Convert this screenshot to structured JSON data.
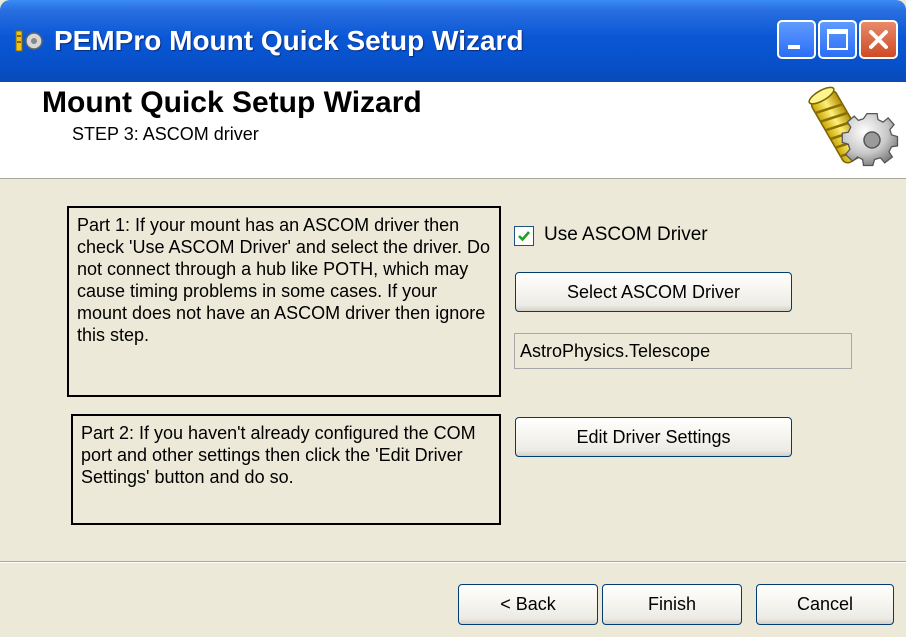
{
  "window": {
    "title": "PEMPro Mount Quick Setup Wizard",
    "title_bar_color": "#0a57d6"
  },
  "header": {
    "heading": "Mount Quick Setup Wizard",
    "step": "STEP 3: ASCOM driver"
  },
  "part1": {
    "text": "Part 1:  If your mount has an ASCOM driver then check 'Use ASCOM Driver' and select the driver. Do not connect through a hub like POTH, which may cause timing problems in some cases.  If your mount does not have an ASCOM driver then ignore this step."
  },
  "part2": {
    "text": "Part 2:  If you haven't already configured the COM port and other settings then click the 'Edit Driver Settings' button and do so."
  },
  "ascom": {
    "use_label": "Use ASCOM Driver",
    "use_checked": true,
    "select_button": "Select ASCOM Driver",
    "driver_name": "AstroPhysics.Telescope",
    "edit_button": "Edit Driver Settings"
  },
  "footer": {
    "back": "< Back",
    "finish": "Finish",
    "cancel": "Cancel"
  }
}
